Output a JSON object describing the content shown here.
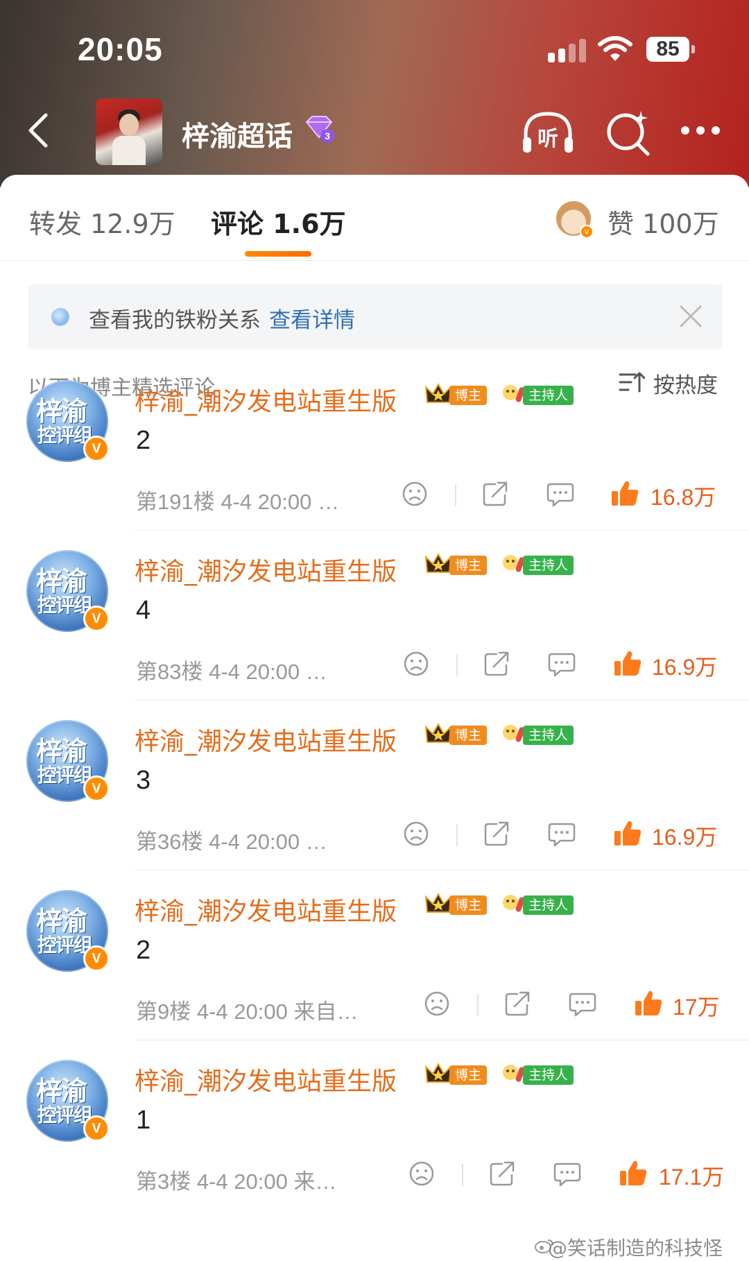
{
  "status_bar": {
    "time": "20:05",
    "battery": "85"
  },
  "nav": {
    "title": "梓渝超话",
    "listen_label": "听"
  },
  "tabs": {
    "repost": "转发 12.9万",
    "comments": "评论 1.6万",
    "likes": "赞 100万"
  },
  "fan_bar": {
    "text": "查看我的铁粉关系",
    "link": "查看详情"
  },
  "section": {
    "note": "以下为博主精选评论",
    "sort_label": "按热度"
  },
  "comments": [
    {
      "name": "梓渝_潮汐发电站重生版",
      "blogger_badge": "博主",
      "host_badge": "主持人",
      "avatar_line1": "梓渝",
      "avatar_line2": "控评组",
      "body": "2",
      "meta": "第191楼 4-4 20:00 …",
      "likes": "16.8万"
    },
    {
      "name": "梓渝_潮汐发电站重生版",
      "blogger_badge": "博主",
      "host_badge": "主持人",
      "avatar_line1": "梓渝",
      "avatar_line2": "控评组",
      "body": "4",
      "meta": "第83楼 4-4 20:00 …",
      "likes": "16.9万"
    },
    {
      "name": "梓渝_潮汐发电站重生版",
      "blogger_badge": "博主",
      "host_badge": "主持人",
      "avatar_line1": "梓渝",
      "avatar_line2": "控评组",
      "body": "3",
      "meta": "第36楼 4-4 20:00 …",
      "likes": "16.9万"
    },
    {
      "name": "梓渝_潮汐发电站重生版",
      "blogger_badge": "博主",
      "host_badge": "主持人",
      "avatar_line1": "梓渝",
      "avatar_line2": "控评组",
      "body": "2",
      "meta": "第9楼 4-4 20:00 来自…",
      "likes": "17万"
    },
    {
      "name": "梓渝_潮汐发电站重生版",
      "blogger_badge": "博主",
      "host_badge": "主持人",
      "avatar_line1": "梓渝",
      "avatar_line2": "控评组",
      "body": "1",
      "meta": "第3楼 4-4 20:00 来…",
      "likes": "17.1万"
    }
  ],
  "watermark": "@笑话制造的科技怪",
  "colors": {
    "accent_orange": "#e46d1b",
    "like_orange": "#e85d1a",
    "link_blue": "#2f6fb6",
    "host_green": "#37b24b",
    "blogger_orange": "#f08c1d"
  }
}
